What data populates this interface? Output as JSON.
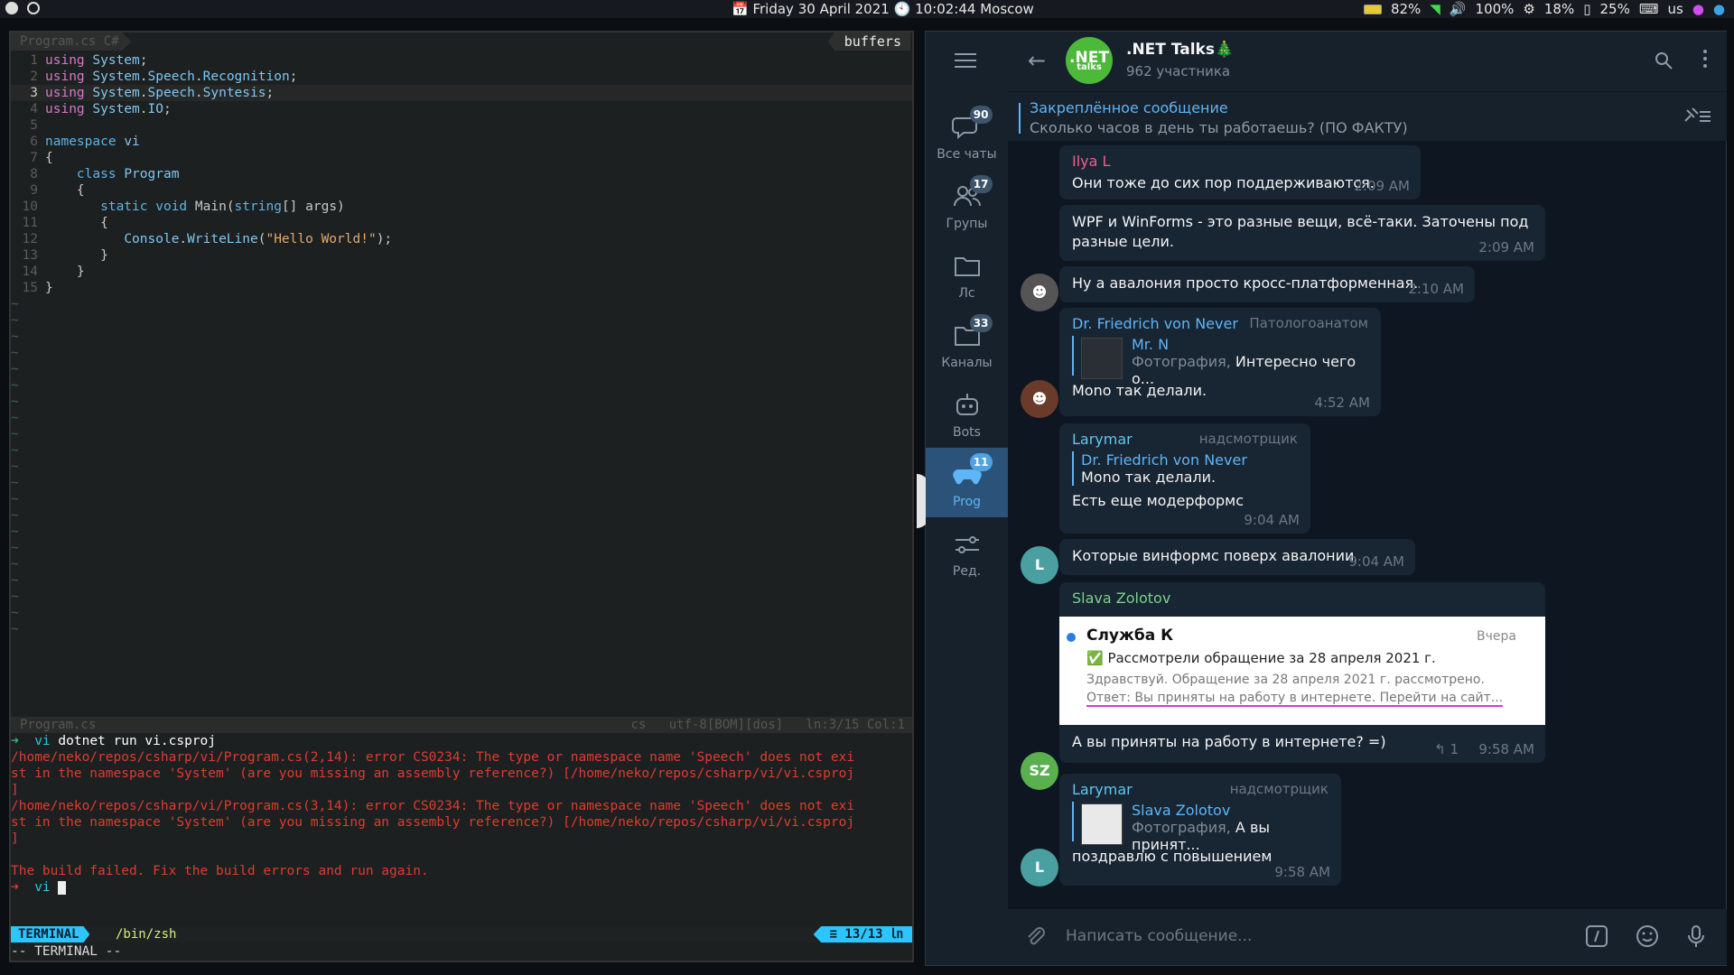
{
  "topbar": {
    "date_day": "Friday",
    "date": "30 April 2021",
    "time": "10:02:44 Moscow",
    "battery": "82%",
    "volume": "100%",
    "cpu": "18%",
    "mem": "25%",
    "layout": "us"
  },
  "editor": {
    "tab_label": "Program.cs C#",
    "buffers_label": "buffers",
    "status_file": "Program.cs",
    "status_ft": "cs",
    "status_enc": "utf-8[BOM][dos]",
    "status_pos": "ln:3/15 Col:1",
    "code": [
      {
        "n": "1",
        "parts": [
          [
            "kw",
            "using"
          ],
          [
            "plain",
            " "
          ],
          [
            "ns",
            "System"
          ],
          [
            "plain",
            ";"
          ]
        ]
      },
      {
        "n": "2",
        "parts": [
          [
            "kw",
            "using"
          ],
          [
            "plain",
            " "
          ],
          [
            "ns",
            "System"
          ],
          [
            "plain",
            "."
          ],
          [
            "ns",
            "Speech"
          ],
          [
            "plain",
            "."
          ],
          [
            "ns",
            "Recognition"
          ],
          [
            "plain",
            ";"
          ]
        ]
      },
      {
        "n": "3",
        "cur": true,
        "parts": [
          [
            "kw",
            "using"
          ],
          [
            "plain",
            " "
          ],
          [
            "ns",
            "System"
          ],
          [
            "plain",
            "."
          ],
          [
            "ns",
            "Speech"
          ],
          [
            "plain",
            "."
          ],
          [
            "ns",
            "Syntesis"
          ],
          [
            "plain",
            ";"
          ]
        ]
      },
      {
        "n": "4",
        "parts": [
          [
            "kw",
            "using"
          ],
          [
            "plain",
            " "
          ],
          [
            "ns",
            "System"
          ],
          [
            "plain",
            "."
          ],
          [
            "ns",
            "IO"
          ],
          [
            "plain",
            ";"
          ]
        ]
      },
      {
        "n": "5",
        "parts": []
      },
      {
        "n": "6",
        "parts": [
          [
            "kw2",
            "namespace"
          ],
          [
            "plain",
            " "
          ],
          [
            "ns",
            "vi"
          ]
        ]
      },
      {
        "n": "7",
        "parts": [
          [
            "plain",
            "{"
          ]
        ]
      },
      {
        "n": "8",
        "parts": [
          [
            "plain",
            "    "
          ],
          [
            "kw2",
            "class"
          ],
          [
            "plain",
            " "
          ],
          [
            "ns",
            "Program"
          ]
        ]
      },
      {
        "n": "9",
        "parts": [
          [
            "plain",
            "    {"
          ]
        ]
      },
      {
        "n": "10",
        "parts": [
          [
            "plain",
            "       "
          ],
          [
            "kw2",
            "static"
          ],
          [
            "plain",
            " "
          ],
          [
            "kw2",
            "void"
          ],
          [
            "plain",
            " "
          ],
          [
            "cls",
            "Main"
          ],
          [
            "plain",
            "("
          ],
          [
            "kw2",
            "string"
          ],
          [
            "plain",
            "[] args)"
          ]
        ]
      },
      {
        "n": "11",
        "parts": [
          [
            "plain",
            "       {"
          ]
        ]
      },
      {
        "n": "12",
        "parts": [
          [
            "plain",
            "          "
          ],
          [
            "ns",
            "Console"
          ],
          [
            "plain",
            "."
          ],
          [
            "ns",
            "WriteLine"
          ],
          [
            "plain",
            "("
          ],
          [
            "str",
            "\"Hello World!\""
          ],
          [
            "plain",
            ");"
          ]
        ]
      },
      {
        "n": "13",
        "parts": [
          [
            "plain",
            "       }"
          ]
        ]
      },
      {
        "n": "14",
        "parts": [
          [
            "plain",
            "    }"
          ]
        ]
      },
      {
        "n": "15",
        "parts": [
          [
            "plain",
            "}"
          ]
        ]
      }
    ],
    "tilde_count": 21,
    "terminal": {
      "prompt_cmd": "dotnet run vi.csproj",
      "prompt_dir": "vi",
      "error1_a": "/home/neko/repos/csharp/vi/Program.cs(2,14): error CS0234: The type or namespace name 'Speech' does not exi",
      "error1_b": "st in the namespace 'System' (are you missing an assembly reference?) [/home/neko/repos/csharp/vi/vi.csproj",
      "error1_c": "]",
      "error2_a": "/home/neko/repos/csharp/vi/Program.cs(3,14): error CS0234: The type or namespace name 'Speech' does not exi",
      "error2_b": "st in the namespace 'System' (are you missing an assembly reference?) [/home/neko/repos/csharp/vi/vi.csproj",
      "error2_c": "]",
      "failed": "The build failed. Fix the build errors and run again.",
      "badge": "TERMINAL",
      "shell": "/bin/zsh",
      "pos": "≡ 13/13 ㏑",
      "mode": "-- TERMINAL --"
    }
  },
  "telegram": {
    "folders": [
      {
        "label": "Все чаты",
        "badge": "90",
        "icon": "chats-icon"
      },
      {
        "label": "Групы",
        "badge": "17",
        "icon": "group-icon"
      },
      {
        "label": "Лс",
        "badge": "",
        "icon": "folder-icon"
      },
      {
        "label": "Каналы",
        "badge": "33",
        "icon": "folder-icon"
      },
      {
        "label": "Bots",
        "badge": "",
        "icon": "bot-icon"
      },
      {
        "label": "Prog",
        "badge": "11",
        "icon": "gamepad-icon"
      },
      {
        "label": "Ред.",
        "badge": "",
        "icon": "sliders-icon"
      }
    ],
    "chat": {
      "avatar_text": ".NET",
      "avatar_sub": "talks",
      "title": ".NET Talks🎄",
      "members": "962 участника"
    },
    "pinned": {
      "title": "Закреплённое сообщение",
      "text": "Сколько часов  в день ты работаешь? (ПО ФАКТУ)"
    },
    "messages": {
      "m1_sender": "Ilya L",
      "m1_text": "Они тоже до сих пор поддерживаются.",
      "m1_time": "2:09 AM",
      "m2_text1": "WPF и WinForms - это разные вещи, всё-таки. Заточены под",
      "m2_text2": "разные цели.",
      "m2_time": "2:09 AM",
      "m3_text": "Ну а авалония просто кросс-платформенная.",
      "m3_time": "2:10 AM",
      "m4_sender": "Dr. Friedrich von Never",
      "m4_rank": "Патологоанатом",
      "m4_reply_name": "Mr. N",
      "m4_reply_type": "Фотография,",
      "m4_reply_text": " Интересно чего о...",
      "m4_text": "Mono так делали.",
      "m4_time": "4:52 AM",
      "m5_sender": "Larymar",
      "m5_rank": "надсмотрщик",
      "m5_reply_name": "Dr. Friedrich von Never",
      "m5_reply_text": "Mono так делали.",
      "m5_text": "Есть еще модерформс",
      "m5_time": "9:04 AM",
      "m6_text": "Которые винформс поверх авалонии",
      "m6_time": "9:04 AM",
      "m6_avatar": "L",
      "m7_sender": "Slava Zolotov",
      "m7_shot_title": "Служба К",
      "m7_shot_when": "Вчера",
      "m7_shot_line1": "✅ Рассмотрели обращение за 28 апреля 2021 г.",
      "m7_shot_line2": "Здравствуй. Обращение за 28 апреля 2021 г. рассмотрено.",
      "m7_shot_line3": "Ответ: Вы приняты на работу в интернете. Перейти на сайт...",
      "m7_text": "А вы приняты на работу в интернете? =)",
      "m7_replies": "1",
      "m7_time": "9:58 AM",
      "m7_avatar": "SZ",
      "m8_sender": "Larymar",
      "m8_rank": "надсмотрщик",
      "m8_reply_name": "Slava Zolotov",
      "m8_reply_type": "Фотография,",
      "m8_reply_text": " А вы принят...",
      "m8_text": "поздравлю с повышением",
      "m8_time": "9:58 AM",
      "m8_avatar": "L"
    },
    "composer_placeholder": "Написать сообщение..."
  },
  "colors": {
    "accent": "#5eb5f7",
    "ilya": "#f25f8c",
    "friedrich": "#5eb5f7",
    "larymar": "#60c6ee",
    "slava": "#7bd08a"
  }
}
